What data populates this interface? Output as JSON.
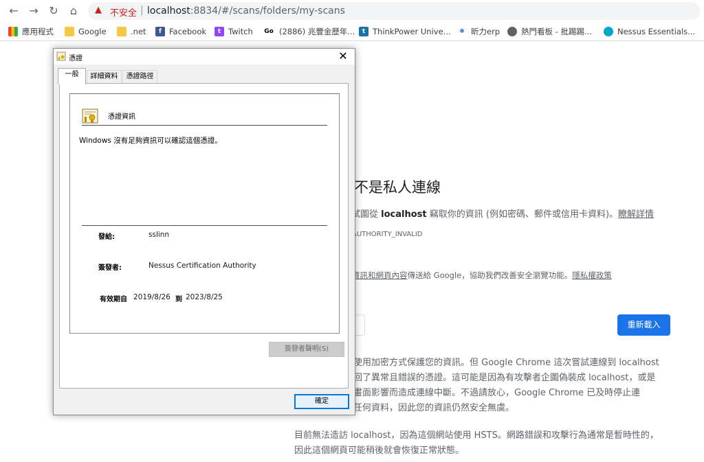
{
  "browser": {
    "security_label": "不安全",
    "url_host": "localhost",
    "url_rest": ":8834/#/scans/folders/my-scans",
    "bookmarks": [
      {
        "label": "應用程式"
      },
      {
        "label": "Google"
      },
      {
        "label": ".net"
      },
      {
        "label": "Facebook"
      },
      {
        "label": "Twitch"
      },
      {
        "label": "(2886) 兆豐金歷年..."
      },
      {
        "label": "ThinkPower Unive..."
      },
      {
        "label": "昕力erp"
      },
      {
        "label": "熱門看板 - 批踢踢..."
      },
      {
        "label": "Nessus Essentials..."
      }
    ]
  },
  "error_page": {
    "title": "不是私人連線",
    "line1_pre": "試圖從 ",
    "line1_host": "localhost",
    "line1_post": " 竊取你的資訊 (例如密碼、郵件或信用卡資料)。",
    "learn_more": "瞭解詳情",
    "error_code": "AUTHORITY_INVALID",
    "safe_browsing_link": "資訊和網頁內容",
    "safe_browsing_text": "傳送給 Google，協助我們改善安全瀏覽功能。",
    "privacy_policy": "隱私權政策",
    "reload_button": "重新載入",
    "details_lines": [
      "使用加密方式保護您的資訊。但 Google Chrome 這次嘗試連線到 localhost",
      "回了異常且錯誤的憑證。這可能是因為有攻擊者企圖偽裝成 localhost，或是",
      "畫面影響而造成連線中斷。不過請放心，Google Chrome 已及時停止連",
      "任何資料，因此您的資訊仍然安全無虞。"
    ],
    "hsts_lines": [
      "目前無法造訪 localhost，因為這個網站使用 HSTS。網路錯誤和攻擊行為通常是暫時性的，",
      "因此這個網頁可能稍後就會恢復正常狀態。"
    ]
  },
  "dialog": {
    "title": "憑證",
    "tabs": [
      "一般",
      "詳細資料",
      "憑證路徑"
    ],
    "info_title": "憑證資訊",
    "message": "Windows 沒有足夠資訊可以確認這個憑證。",
    "issued_to_label": "發給:",
    "issued_to_value": "sslinn",
    "issued_by_label": "簽發者:",
    "issued_by_value": "Nessus Certification Authority",
    "valid_from_label": "有效期自",
    "valid_from": "2019/8/26",
    "valid_to_label": "到",
    "valid_to": "2023/8/25",
    "issuer_statement_button": "簽發者聲明(S)",
    "ok_button": "確定"
  }
}
